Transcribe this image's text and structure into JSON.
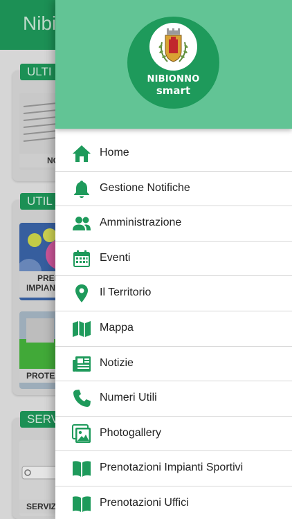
{
  "app": {
    "title": "Nibi"
  },
  "background": {
    "sections": [
      {
        "tag": "ULTI",
        "caption": "NO"
      },
      {
        "tag": "UTIL",
        "captions": [
          "PRENO",
          "IMPIANT",
          "PROTEZIO"
        ]
      },
      {
        "tag": "SERV",
        "caption": "SERVIZ"
      }
    ]
  },
  "drawer": {
    "logo": {
      "name": "NIBIONNO",
      "sub": "smart"
    },
    "menu": [
      {
        "label": "Home",
        "icon": "home-icon"
      },
      {
        "label": "Gestione Notifiche",
        "icon": "bell-icon"
      },
      {
        "label": "Amministrazione",
        "icon": "people-icon"
      },
      {
        "label": "Eventi",
        "icon": "calendar-icon"
      },
      {
        "label": "Il Territorio",
        "icon": "map-pin-icon"
      },
      {
        "label": "Mappa",
        "icon": "map-icon"
      },
      {
        "label": "Notizie",
        "icon": "newspaper-icon"
      },
      {
        "label": "Numeri Utili",
        "icon": "phone-icon"
      },
      {
        "label": "Photogallery",
        "icon": "images-icon"
      },
      {
        "label": "Prenotazioni Impianti Sportivi",
        "icon": "book-icon"
      },
      {
        "label": "Prenotazioni Uffici",
        "icon": "book-icon"
      }
    ]
  },
  "colors": {
    "brand_green": "#1e9a5b",
    "header_green": "#62c495",
    "icon_green": "#1e9a5b"
  }
}
